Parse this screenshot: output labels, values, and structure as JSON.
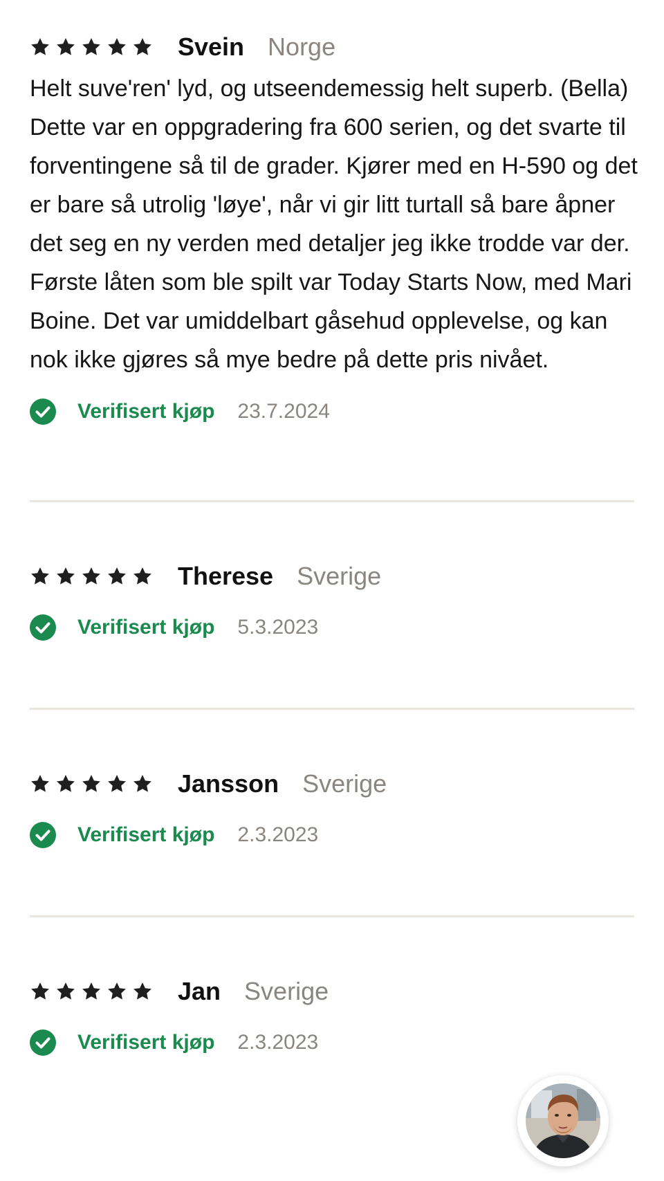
{
  "reviews": [
    {
      "rating": 5,
      "author": "Svein",
      "country": "Norge",
      "text": "Helt suve'ren' lyd, og utseendemessig helt superb. (Bella) Dette var en oppgradering fra 600 serien, og det svarte til forventingene så til de grader. Kjører med en H-590 og det er bare så utrolig 'løye', når vi gir litt turtall så bare åpner det seg en ny verden med detaljer jeg ikke trodde var der. Første låten som ble spilt var Today Starts Now, med Mari Boine. Det var umiddelbart gåsehud opplevelse, og kan nok ikke gjøres så mye bedre på dette pris nivået.",
      "verified_label": "Verifisert kjøp",
      "date": "23.7.2024"
    },
    {
      "rating": 5,
      "author": "Therese",
      "country": "Sverige",
      "text": "",
      "verified_label": "Verifisert kjøp",
      "date": "5.3.2023"
    },
    {
      "rating": 5,
      "author": "Jansson",
      "country": "Sverige",
      "text": "",
      "verified_label": "Verifisert kjøp",
      "date": "2.3.2023"
    },
    {
      "rating": 5,
      "author": "Jan",
      "country": "Sverige",
      "text": "",
      "verified_label": "Verifisert kjøp",
      "date": "2.3.2023"
    }
  ],
  "icons": {
    "star": "star-icon",
    "verified": "check-circle-icon",
    "chat_avatar": "avatar"
  },
  "colors": {
    "star": "#1f1f1f",
    "verified": "#1b8a4f",
    "muted": "#8a8580",
    "divider": "#e9e6df"
  }
}
